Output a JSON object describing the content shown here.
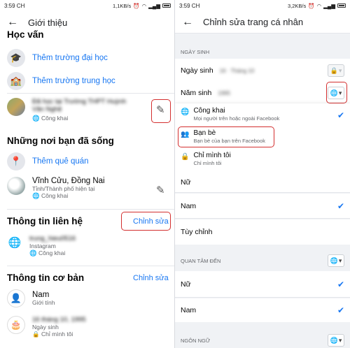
{
  "left": {
    "status": {
      "time": "3:59 CH",
      "speed": "1,1KB/s"
    },
    "header": {
      "title": "Giới thiệu"
    },
    "education": {
      "title": "Học vấn",
      "add_university": "Thêm trường đại học",
      "add_highschool": "Thêm trường trung học",
      "school_name": "Đã học tại Trường THPT Huỳnh Văn Nghệ",
      "school_privacy": "Công khai"
    },
    "places": {
      "title": "Những nơi bạn đã sống",
      "add_hometown": "Thêm quê quán",
      "city": "Vĩnh Cửu, Đồng Nai",
      "city_sub": "Tỉnh/Thành phố hiện tại",
      "city_privacy": "Công khai"
    },
    "contact": {
      "title": "Thông tin liên hệ",
      "edit": "Chỉnh sửa",
      "instagram_user": "trung_hieu0516",
      "instagram_label": "Instagram",
      "instagram_privacy": "Công khai"
    },
    "basic": {
      "title": "Thông tin cơ bản",
      "edit": "Chỉnh sửa",
      "gender": "Nam",
      "gender_label": "Giới tính",
      "birthday": "16 tháng 10, 1995",
      "birthday_label": "Ngày sinh",
      "birthday_privacy": "Chỉ mình tôi"
    }
  },
  "right": {
    "status": {
      "time": "3:59 CH",
      "speed": "3,2KB/s"
    },
    "header": {
      "title": "Chỉnh sửa trang cá nhân"
    },
    "birthday_section": "NGÀY SINH",
    "birth_date_label": "Ngày sinh",
    "birth_date_value": "16 · Tháng 10",
    "birth_year_label": "Năm sinh",
    "birth_year_value": "1995",
    "privacy_menu": [
      {
        "title": "Công khai",
        "sub": "Mọi người trên hoặc ngoài Facebook"
      },
      {
        "title": "Bạn bè",
        "sub": "Bạn bè của bạn trên Facebook"
      },
      {
        "title": "Chỉ mình tôi",
        "sub": "Chỉ mình tôi"
      }
    ],
    "gender_options": [
      "Nữ",
      "Nam",
      "Tùy chỉnh"
    ],
    "interested_section": "QUAN TÂM ĐẾN",
    "interested_options": [
      "Nữ",
      "Nam"
    ],
    "language_section": "NGÔN NGỮ"
  }
}
